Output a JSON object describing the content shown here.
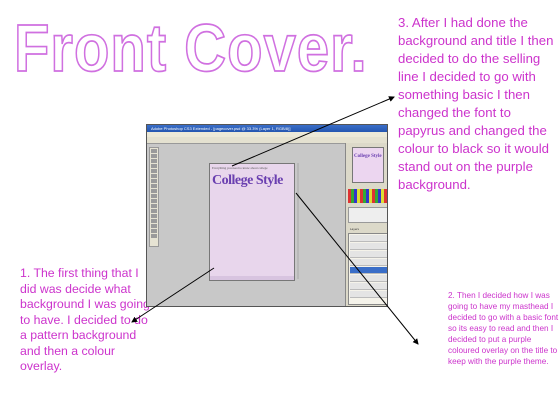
{
  "title": "Front Cover.",
  "notes": {
    "step1": "1. The first thing that I did was decide what background I was going to have. I decided to do a pattern background and then a colour overlay.",
    "step2": "2. Then I decided how I was going to have my masthead I decided to go with a basic font so its easy to read and then I decided to put a purple coloured overlay on the title to keep with the purple theme.",
    "step3": "3. After I had done the background and title I then decided to do the selling line I decided to go with something basic I then changed the font to papyrus and changed the colour to black so it would stand out on the purple background."
  },
  "screenshot": {
    "window_title": "Adobe Photoshop CS3 Extended - [pagecover.psd @ 33.3% (Layer 1, RGB/8)]",
    "canvas": {
      "selling_line": "Everything you need to know about college",
      "masthead": "College Style"
    },
    "navigator_thumb": "College Style",
    "layers_panel_label": "Layers"
  },
  "colors": {
    "annotation_text": "#cc33cc",
    "title_outline": "#d070e0",
    "canvas_bg": "#e8d6ec",
    "masthead": "#6a3fb0"
  }
}
